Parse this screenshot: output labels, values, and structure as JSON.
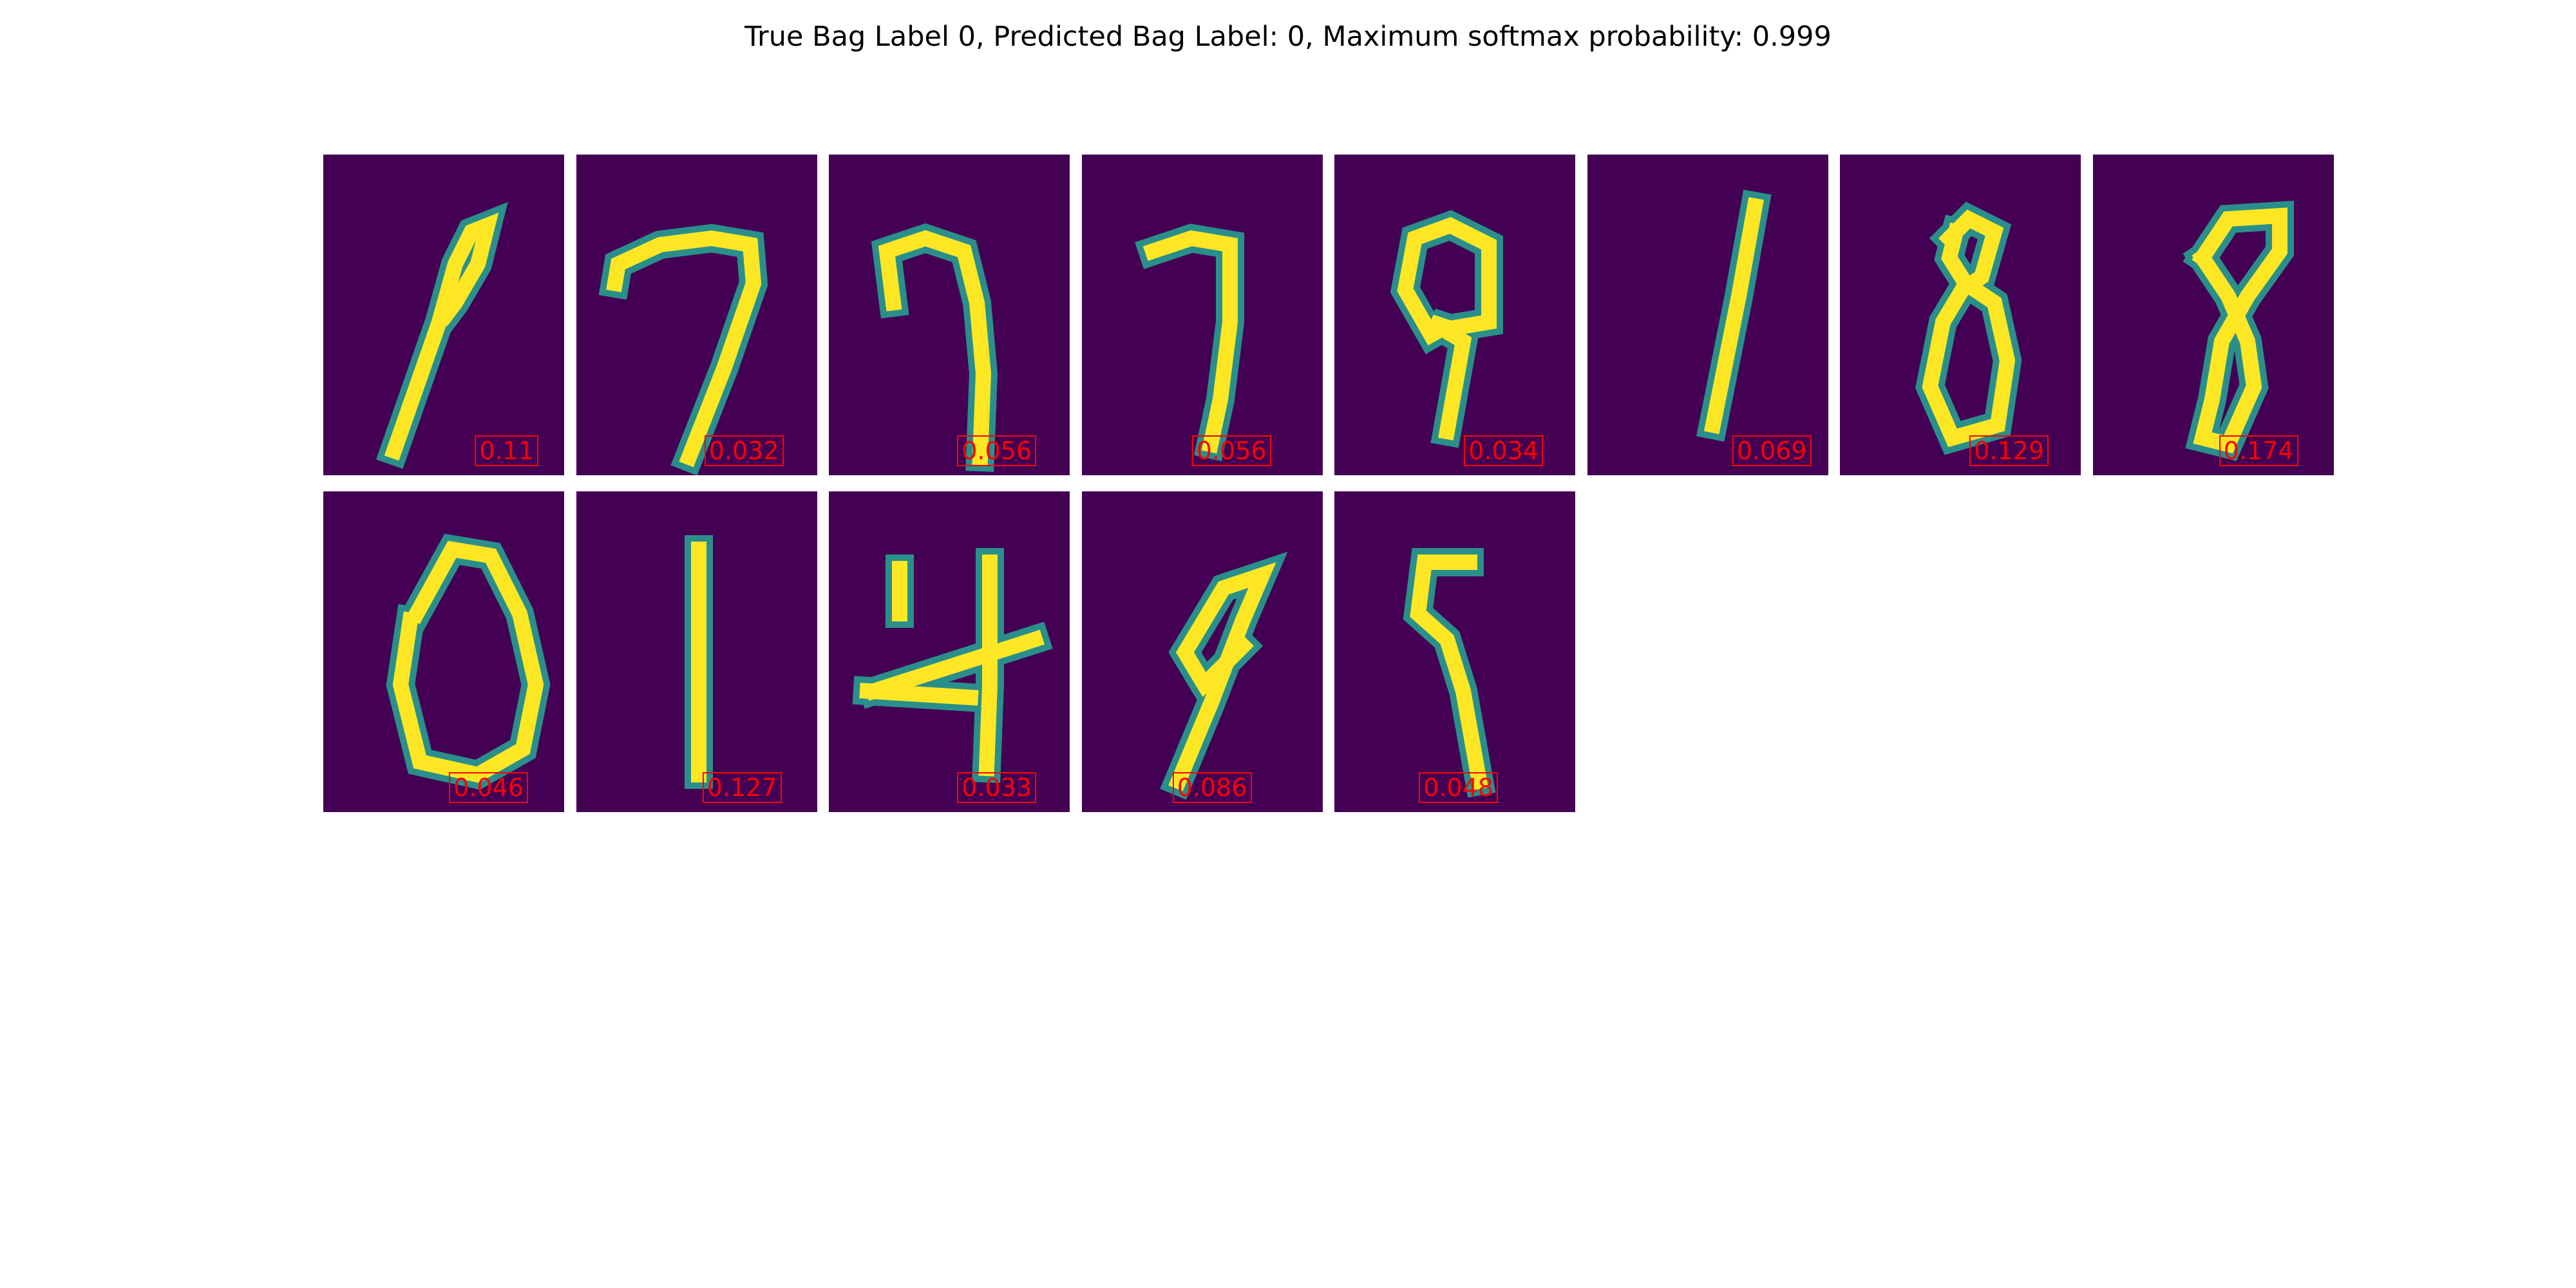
{
  "title": "True Bag Label 0, Predicted Bag Label: 0, Maximum softmax probability: 0.999",
  "colors": {
    "background": "#440154",
    "stroke_core": "#fde725",
    "stroke_edge": "#2a8f8b",
    "score": "#ff0000"
  },
  "instances": [
    {
      "digit": "9",
      "score": "0.11"
    },
    {
      "digit": "7",
      "score": "0.032"
    },
    {
      "digit": "7",
      "score": "0.056"
    },
    {
      "digit": "7",
      "score": "0.056"
    },
    {
      "digit": "9",
      "score": "0.034"
    },
    {
      "digit": "1",
      "score": "0.069"
    },
    {
      "digit": "8",
      "score": "0.129"
    },
    {
      "digit": "8",
      "score": "0.174"
    },
    {
      "digit": "0",
      "score": "0.046"
    },
    {
      "digit": "1",
      "score": "0.127"
    },
    {
      "digit": "4",
      "score": "0.033"
    },
    {
      "digit": "9",
      "score": "0.086"
    },
    {
      "digit": "9",
      "score": "0.048"
    }
  ]
}
